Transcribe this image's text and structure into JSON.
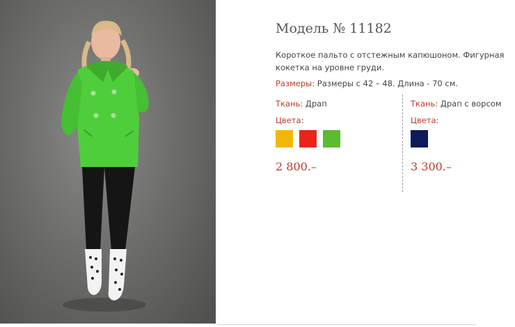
{
  "product": {
    "title": "Модель № 11182",
    "description": "Короткое пальто с отстежным капюшоном. Фигурная кокетка на уровне груди.",
    "sizes_label": "Размеры:",
    "sizes_text": "Размеры с 42 – 48. Длина - 70 см."
  },
  "variants": [
    {
      "fabric_label": "Ткань:",
      "fabric_value": "Драп",
      "colors_label": "Цвета:",
      "swatches": [
        "#f2b705",
        "#e8241b",
        "#5dbb2e"
      ],
      "price": "2 800.–"
    },
    {
      "fabric_label": "Ткань:",
      "fabric_value": "Драп с ворсом",
      "colors_label": "Цвета:",
      "swatches": [
        "#0d1a5c"
      ],
      "price": "3 300.–"
    }
  ],
  "colors": {
    "accent": "#c0392b",
    "text": "#444444",
    "coat": "#4fce3c"
  }
}
